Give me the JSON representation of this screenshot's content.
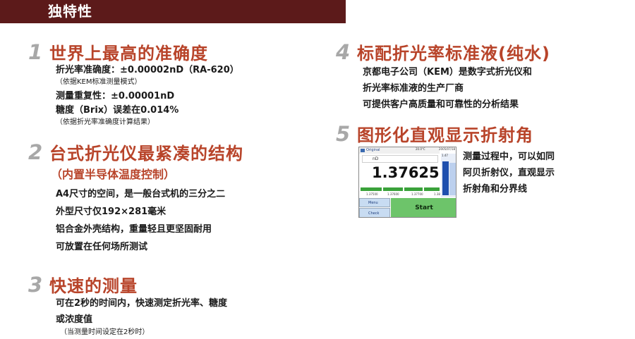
{
  "header": {
    "title": "独特性"
  },
  "features": [
    {
      "num": "1",
      "title": "世界上最高的准确度",
      "lines": [
        {
          "text": "折光率准确度：±0.00002nD（RA-620）",
          "kind": "line"
        },
        {
          "text": "（依据KEM标准测量模式）",
          "kind": "note"
        },
        {
          "text": "测量重复性：±0.00001nD",
          "kind": "line"
        },
        {
          "text": "糖度（Brix）误差在0.014%",
          "kind": "line"
        },
        {
          "text": "（依据折光率准确度计算结果）",
          "kind": "note"
        }
      ]
    },
    {
      "num": "2",
      "title": "台式折光仪最紧凑的结构",
      "subtitle": "（内置半导体温度控制）",
      "lines": [
        {
          "text": "A4尺寸的空间，是一般台式机的三分之二",
          "kind": "line"
        },
        {
          "text": "外型尺寸仅192×281毫米",
          "kind": "line"
        },
        {
          "text": "铝合金外壳结构，重量轻且更坚固耐用",
          "kind": "line"
        },
        {
          "text": "可放置在任何场所测试",
          "kind": "line"
        }
      ]
    },
    {
      "num": "3",
      "title": "快速的测量",
      "lines": [
        {
          "text": "可在2秒的时间内，快速测定折光率、糖度",
          "kind": "line"
        },
        {
          "text": "或浓度值",
          "kind": "line"
        },
        {
          "text": "（当测量时间设定在2秒时）",
          "kind": "note"
        }
      ]
    },
    {
      "num": "4",
      "title": "标配折光率标准液(纯水)",
      "lines": [
        {
          "text": "京都电子公司（KEM）是数字式折光仪和",
          "kind": "line"
        },
        {
          "text": "折光率标准液的生产厂商",
          "kind": "line"
        },
        {
          "text": "可提供客户高质量和可靠性的分析结果",
          "kind": "line"
        }
      ]
    },
    {
      "num": "5",
      "title": "图形化直观显示折射角",
      "lines": [
        {
          "text": "测量过程中，可以如同",
          "kind": "line"
        },
        {
          "text": "阿贝折射仪，直观显示",
          "kind": "line"
        },
        {
          "text": "折射角和分界线",
          "kind": "line"
        }
      ]
    }
  ],
  "device": {
    "mode": "Original",
    "temp": "20.0°C",
    "date": "2005/07/18",
    "unit": "nD",
    "value": "1.37625",
    "ticks": [
      "1.37500",
      "1.37600",
      "1.37700",
      "1.38"
    ],
    "side_value": "1.47",
    "menu": "Menu",
    "check": "Check",
    "start": "Start",
    "bar_color": "#3aa23a",
    "start_color": "#6dc46a"
  }
}
